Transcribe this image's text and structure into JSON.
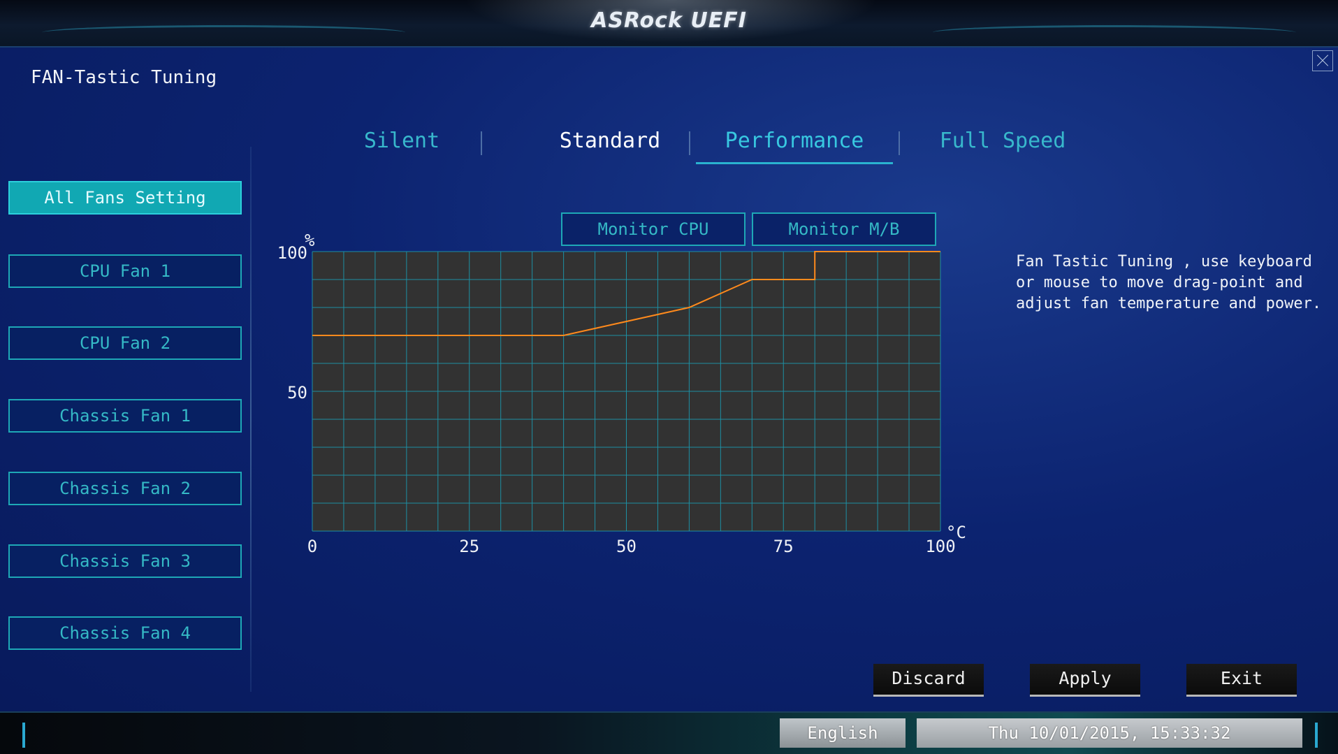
{
  "header": {
    "brand": "ASRock UEFI"
  },
  "page": {
    "title": "FAN-Tastic Tuning"
  },
  "tabs": [
    {
      "label": "Silent"
    },
    {
      "label": "Standard"
    },
    {
      "label": "Performance"
    },
    {
      "label": "Full Speed"
    }
  ],
  "sidebar": {
    "items": [
      {
        "label": "All Fans Setting"
      },
      {
        "label": "CPU Fan 1"
      },
      {
        "label": "CPU Fan 2"
      },
      {
        "label": "Chassis Fan 1"
      },
      {
        "label": "Chassis Fan 2"
      },
      {
        "label": "Chassis Fan 3"
      },
      {
        "label": "Chassis Fan 4"
      }
    ]
  },
  "monitor": {
    "cpu_label": "Monitor CPU",
    "mb_label": "Monitor M/B"
  },
  "chart_data": {
    "type": "line",
    "title": "",
    "xlabel": "°C",
    "ylabel": "%",
    "xlim": [
      0,
      100
    ],
    "ylim": [
      0,
      100
    ],
    "x_ticks": [
      "0",
      "25",
      "50",
      "75",
      "100"
    ],
    "y_ticks": [
      "100",
      "50"
    ],
    "grid": true,
    "series": [
      {
        "x": [
          0,
          40,
          60,
          70,
          80,
          80,
          100
        ],
        "y": [
          70,
          70,
          80,
          90,
          90,
          100,
          100
        ]
      }
    ],
    "colors": {
      "line": "#ff8a1c",
      "plot_bg": "#323232",
      "grid": "#1d8fa3"
    }
  },
  "help": {
    "text": "Fan Tastic Tuning , use keyboard\nor mouse to move drag-point and\nadjust fan temperature and power."
  },
  "actions": {
    "discard": "Discard",
    "apply": "Apply",
    "exit": "Exit"
  },
  "footer": {
    "language": "English",
    "datetime": "Thu 10/01/2015, 15:33:32"
  }
}
